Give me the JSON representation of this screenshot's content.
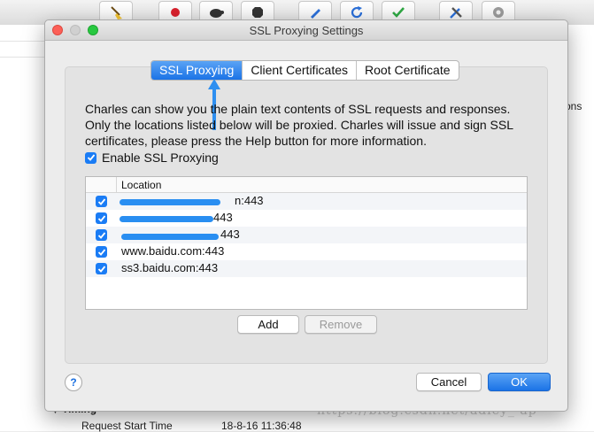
{
  "background": {
    "toolbar_icons": [
      "broom-icon",
      "record-icon",
      "turtle-icon",
      "stop-icon",
      "pen-icon",
      "refresh-icon",
      "check-icon",
      "tools-icon",
      "settings-gear-icon"
    ],
    "right_truncated_text": "ons",
    "timing_label": "Timing",
    "request_start_label": "Request Start Time",
    "request_start_value": "18-8-16 11:36:48",
    "watermark": "https://blog.csdn.net/adley_ ap"
  },
  "dialog": {
    "title": "SSL Proxying Settings",
    "tabs": [
      {
        "label": "SSL Proxying",
        "active": true
      },
      {
        "label": "Client Certificates",
        "active": false
      },
      {
        "label": "Root Certificate",
        "active": false
      }
    ],
    "description_lines": [
      "Charles can show you the plain text contents of SSL requests and responses.",
      "Only the locations listed below will be proxied. Charles will issue and sign SSL",
      "certificates, please press the Help button for more information."
    ],
    "enable_ssl_proxying": {
      "label": "Enable SSL Proxying",
      "checked": true
    },
    "table": {
      "column_header": "Location",
      "rows": [
        {
          "checked": true,
          "location": "n:443"
        },
        {
          "checked": true,
          "location": "443"
        },
        {
          "checked": true,
          "location": "443"
        },
        {
          "checked": true,
          "location": "www.baidu.com:443"
        },
        {
          "checked": true,
          "location": "ss3.baidu.com:443"
        }
      ]
    },
    "buttons": {
      "add": "Add",
      "remove": "Remove",
      "help": "?",
      "cancel": "Cancel",
      "ok": "OK"
    },
    "colors": {
      "accent": "#1b73e6",
      "annotation_arrow": "#2e8ff0",
      "close": "#fc5f57",
      "minimize": "#fdbb2e",
      "zoom": "#28c840"
    }
  }
}
